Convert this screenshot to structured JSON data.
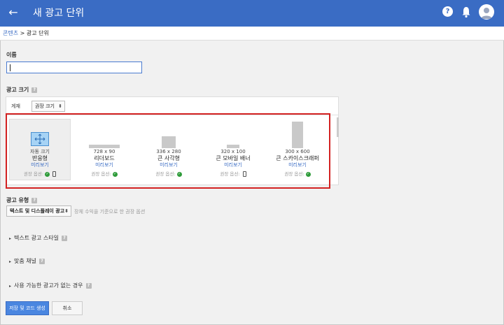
{
  "header": {
    "title": "새 광고 단위",
    "back_icon": "arrow-back-icon",
    "help_icon": "help-icon",
    "bell_icon": "notification-bell-icon",
    "avatar_icon": "account-avatar-icon",
    "bar_color": "#3a6cc4"
  },
  "breadcrumb": {
    "root": "콘텐츠",
    "separator": " > ",
    "current": "광고 단위"
  },
  "name_section": {
    "label": "이름",
    "value": ""
  },
  "size_section": {
    "label": "광고 크기",
    "header_label": "게재",
    "sort_value": "권장 크기",
    "cards": [
      {
        "dims": "자동 크기",
        "name": "반응형",
        "preview": "미리보기",
        "recommended": "권장 옵션:",
        "mobile": true,
        "selected": true
      },
      {
        "dims": "728 x 90",
        "name": "리더보드",
        "preview": "미리보기",
        "recommended": "권장 옵션:",
        "mobile": false,
        "selected": false
      },
      {
        "dims": "336 x 280",
        "name": "큰 사각형",
        "preview": "미리보기",
        "recommended": "권장 옵션:",
        "mobile": false,
        "selected": false
      },
      {
        "dims": "320 x 100",
        "name": "큰 모바일 배너",
        "preview": "미리보기",
        "recommended": "권장 옵션:",
        "mobile": true,
        "selected": false
      },
      {
        "dims": "300 x 600",
        "name": "큰 스카이스크래퍼",
        "preview": "미리보기",
        "recommended": "권장 옵션:",
        "mobile": false,
        "selected": false
      }
    ]
  },
  "ad_type_section": {
    "label": "광고 유형",
    "select_value": "텍스트 및 디스플레이 광고",
    "hint": "장체 수익을 기준으로 한 권장 옵션"
  },
  "expanders": [
    {
      "label": "텍스트 광고 스타일"
    },
    {
      "label": "맞춤 채널"
    },
    {
      "label": "사용 가능한 광고가 없는 경우"
    }
  ],
  "actions": {
    "save_label": "저장 및 코드 생성",
    "cancel_label": "취소"
  }
}
